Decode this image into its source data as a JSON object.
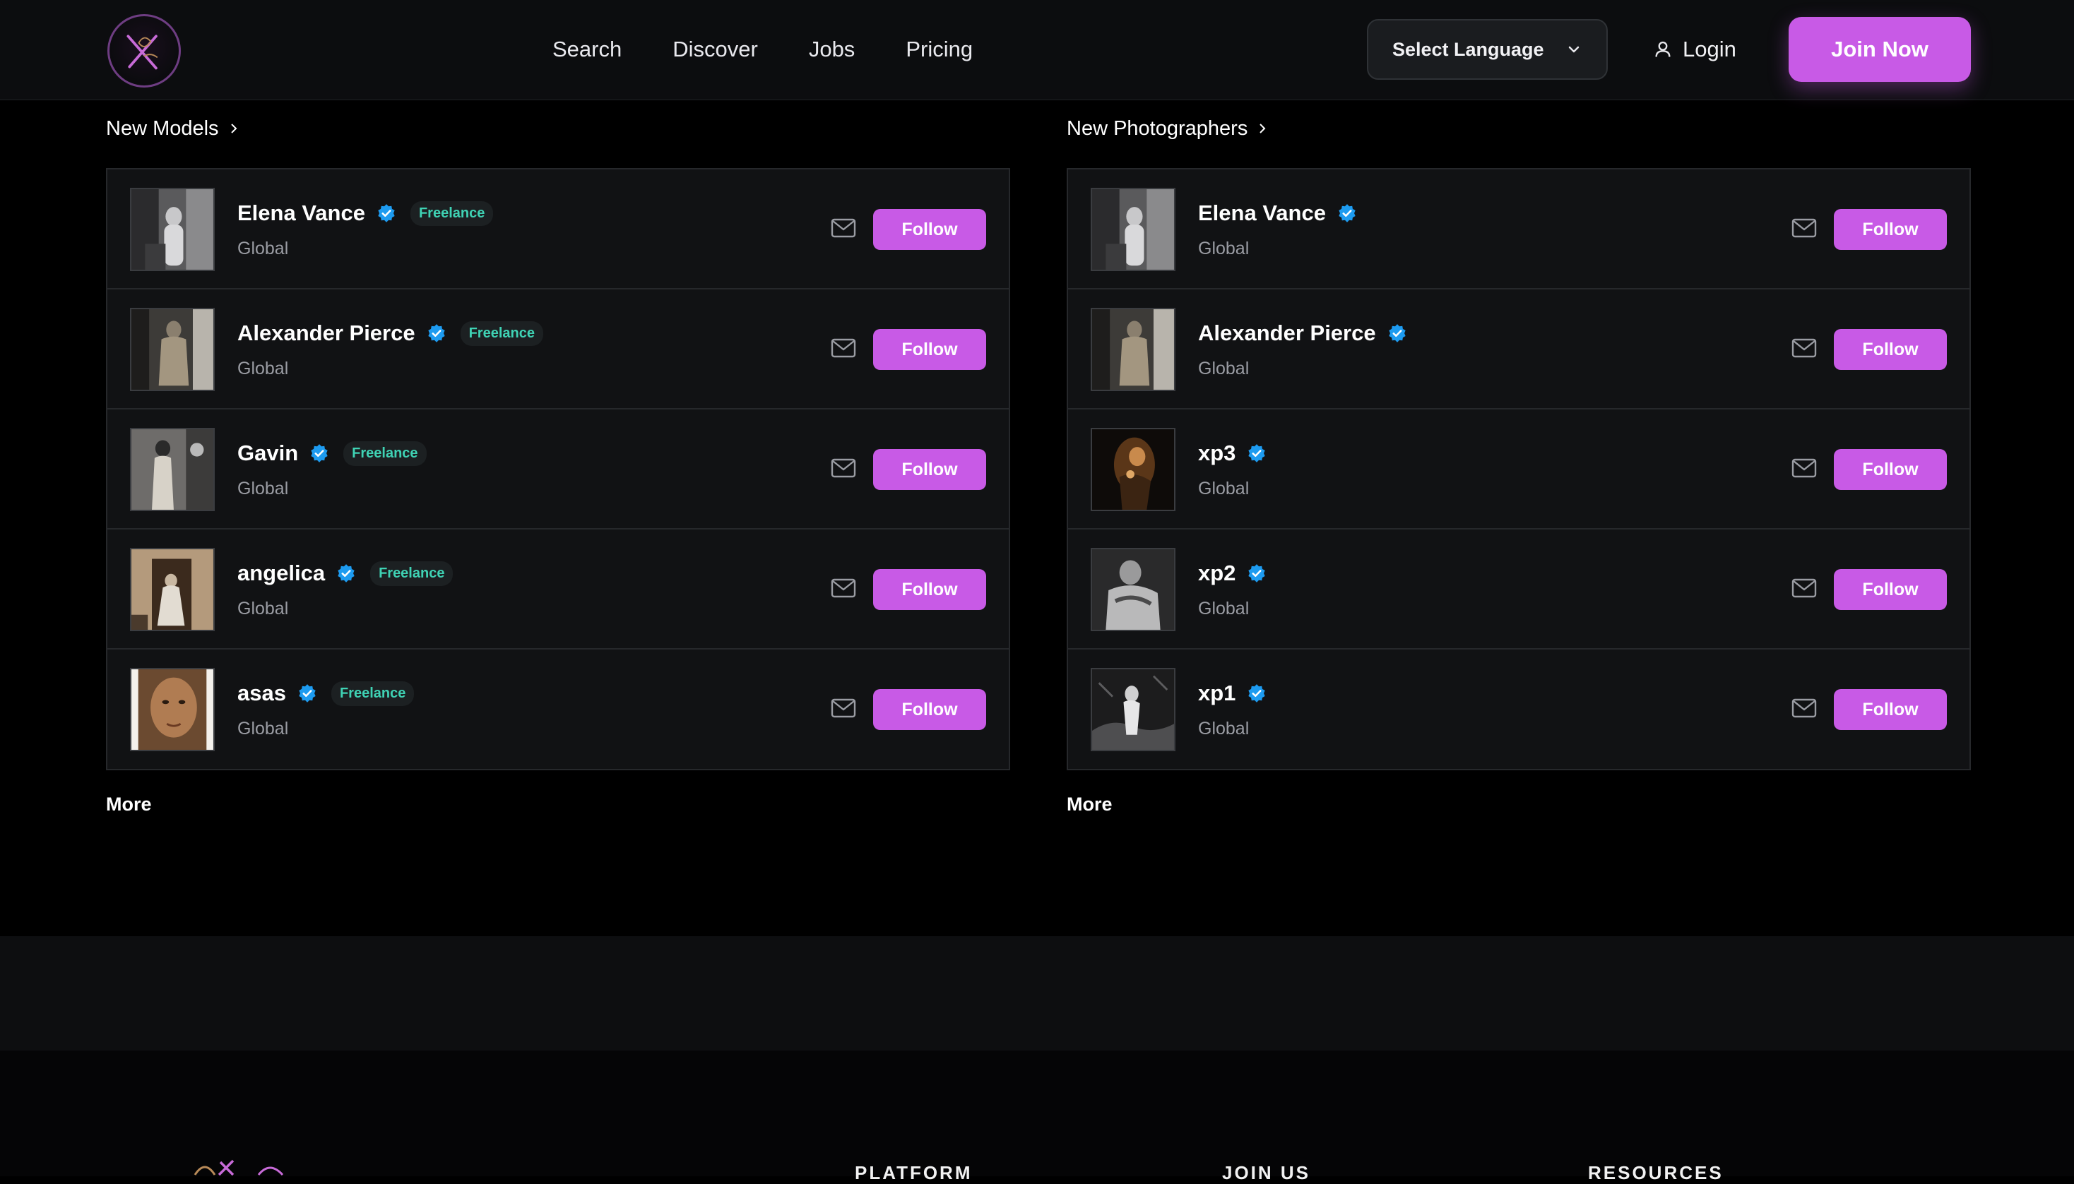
{
  "header": {
    "nav": [
      "Search",
      "Discover",
      "Jobs",
      "Pricing"
    ],
    "language_label": "Select Language",
    "login_label": "Login",
    "join_label": "Join Now"
  },
  "models": {
    "title": "New Models",
    "more_label": "More",
    "items": [
      {
        "name": "Elena Vance",
        "badge": "Freelance",
        "location": "Global",
        "follow_label": "Follow"
      },
      {
        "name": "Alexander Pierce",
        "badge": "Freelance",
        "location": "Global",
        "follow_label": "Follow"
      },
      {
        "name": "Gavin",
        "badge": "Freelance",
        "location": "Global",
        "follow_label": "Follow"
      },
      {
        "name": "angelica",
        "badge": "Freelance",
        "location": "Global",
        "follow_label": "Follow"
      },
      {
        "name": "asas",
        "badge": "Freelance",
        "location": "Global",
        "follow_label": "Follow"
      }
    ]
  },
  "photographers": {
    "title": "New Photographers",
    "more_label": "More",
    "items": [
      {
        "name": "Elena Vance",
        "location": "Global",
        "follow_label": "Follow"
      },
      {
        "name": "Alexander Pierce",
        "location": "Global",
        "follow_label": "Follow"
      },
      {
        "name": "xp3",
        "location": "Global",
        "follow_label": "Follow"
      },
      {
        "name": "xp2",
        "location": "Global",
        "follow_label": "Follow"
      },
      {
        "name": "xp1",
        "location": "Global",
        "follow_label": "Follow"
      }
    ]
  },
  "footer": {
    "columns": [
      "PLATFORM",
      "JOIN US",
      "RESOURCES"
    ]
  },
  "colors": {
    "accent": "#c85ae6",
    "verified": "#1d9bf0",
    "badge_text": "#3fd2b4"
  }
}
